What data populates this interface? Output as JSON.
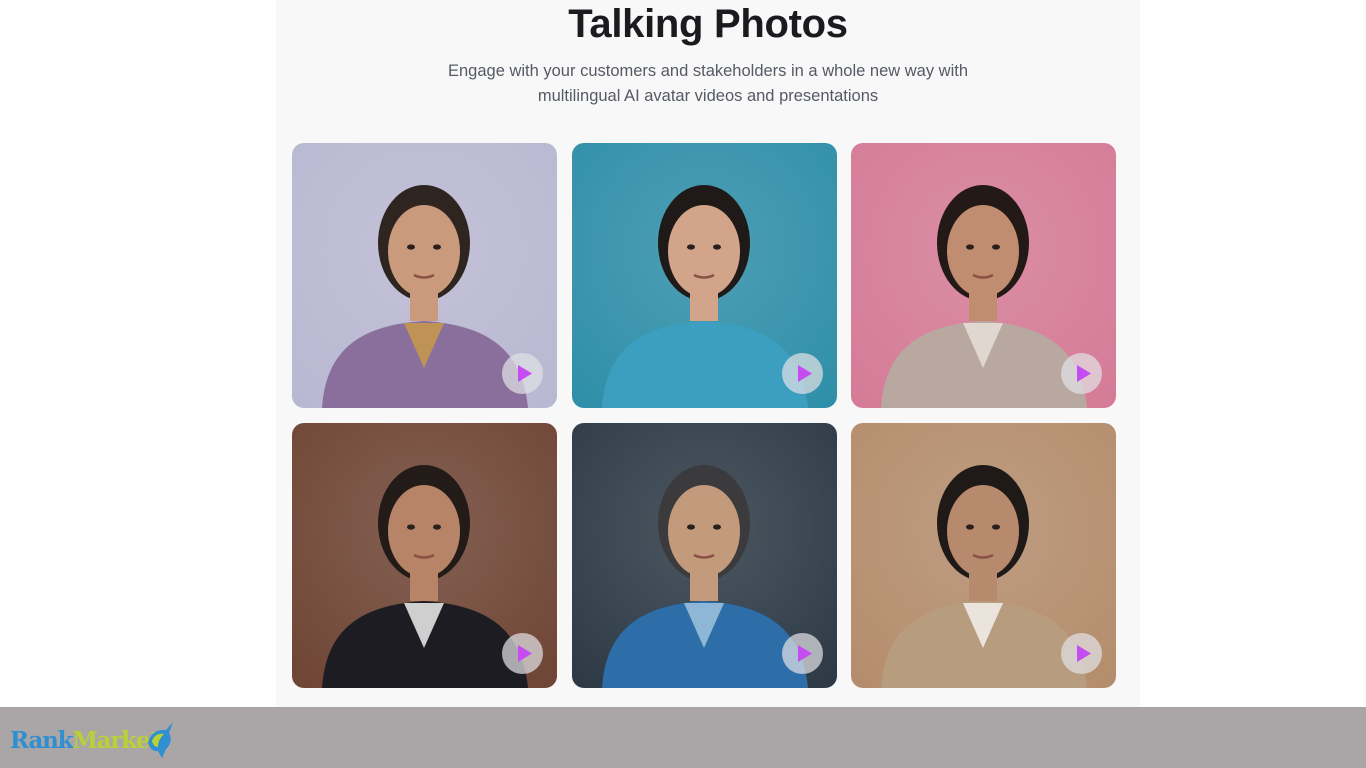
{
  "header": {
    "title": "Talking Photos",
    "subtitle_line1": "Engage with your customers and stakeholders in a whole new way with",
    "subtitle_line2": "multilingual AI avatar videos and presentations"
  },
  "cards": [
    {
      "bg": "#b9b8d2",
      "hair": "#2e2520",
      "skin": "#c99a7c",
      "shirt": "#8a6f9c",
      "accent": "#c89a4a"
    },
    {
      "bg": "#2f8fa8",
      "hair": "#1f1a18",
      "skin": "#d2a48a",
      "shirt": "#3c9fbf",
      "accent": "#3c9fbf"
    },
    {
      "bg": "#d57b97",
      "hair": "#231a17",
      "skin": "#c08d70",
      "shirt": "#b9a8a0",
      "accent": "#e6dfd8"
    },
    {
      "bg": "#6f4535",
      "hair": "#221b18",
      "skin": "#b88468",
      "shirt": "#1c1c22",
      "accent": "#eeeeee"
    },
    {
      "bg": "#2d3a46",
      "hair": "#3b3b3d",
      "skin": "#c39a7c",
      "shirt": "#2d6da8",
      "accent": "#9fc3df"
    },
    {
      "bg": "#b48d6c",
      "hair": "#1f1a17",
      "skin": "#b78a6e",
      "shirt": "#b89c7e",
      "accent": "#f3f1ec"
    }
  ],
  "play_icon_color": "#c44cf0",
  "footer": {
    "logo_part1": "Rank",
    "logo_part2": "Market"
  }
}
